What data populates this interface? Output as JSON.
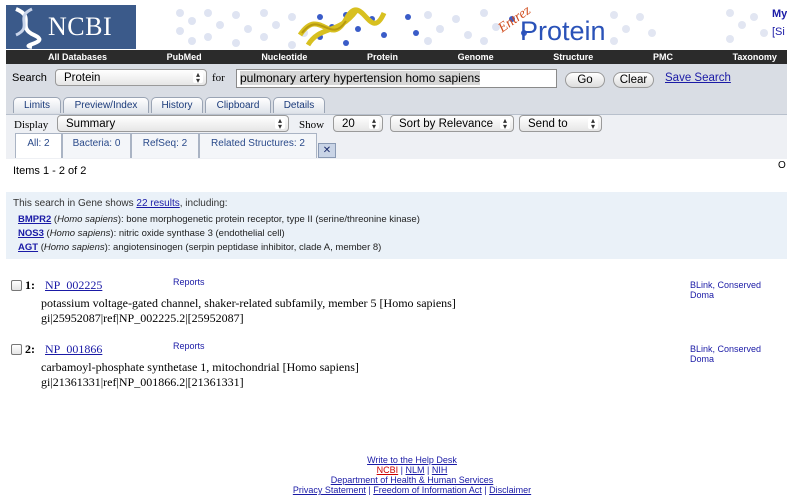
{
  "header": {
    "logo_text": "NCBI",
    "banner_title": "Protein",
    "banner_entrez": "Entrez",
    "my_label": "My",
    "my_sign": "[Si"
  },
  "nav": [
    "All Databases",
    "PubMed",
    "Nucleotide",
    "Protein",
    "Genome",
    "Structure",
    "PMC",
    "Taxonomy"
  ],
  "search": {
    "label": "Search",
    "database": "Protein",
    "for_label": "for",
    "term": "pulmonary artery hypertension homo sapiens",
    "go_label": "Go",
    "clear_label": "Clear",
    "save_label": "Save Search"
  },
  "tabs": [
    "Limits",
    "Preview/Index",
    "History",
    "Clipboard",
    "Details"
  ],
  "display": {
    "label": "Display",
    "value": "Summary",
    "show_label": "Show",
    "show_value": "20",
    "sort_value": "Sort by Relevance",
    "send_value": "Send to"
  },
  "filter_tabs": [
    "All: 2",
    "Bacteria: 0",
    "RefSeq: 2",
    "Related Structures: 2"
  ],
  "items_text": "Items 1 - 2 of 2",
  "edge_text": "O",
  "gene": {
    "intro_pre": "This search in Gene shows ",
    "intro_link": "22 results",
    "intro_post": ", including:",
    "lines": [
      {
        "sym": "BMPR2",
        "org": "Homo sapiens",
        "desc": ": bone morphogenetic protein receptor, type II (serine/threonine kinase)"
      },
      {
        "sym": "NOS3",
        "org": "Homo sapiens",
        "desc": ": nitric oxide synthase 3 (endothelial cell)"
      },
      {
        "sym": "AGT",
        "org": "Homo sapiens",
        "desc": ": angiotensinogen (serpin peptidase inhibitor, clade A, member 8)"
      }
    ]
  },
  "results": [
    {
      "num": "1:",
      "acc": "NP_002225",
      "reports": "Reports",
      "desc": "potassium voltage-gated channel, shaker-related subfamily, member 5 [Homo sapiens]",
      "ids": "gi|25952087|ref|NP_002225.2|[25952087]",
      "links": "BLink, Conserved Doma"
    },
    {
      "num": "2:",
      "acc": "NP_001866",
      "reports": "Reports",
      "desc": "carbamoyl-phosphate synthetase 1, mitochondrial [Homo sapiens]",
      "ids": "gi|21361331|ref|NP_001866.2|[21361331]",
      "links": "BLink, Conserved Doma"
    }
  ],
  "footer": {
    "help": "Write to the Help Desk",
    "ncbi": "NCBI",
    "sep1": " | ",
    "nlm": "NLM",
    "sep2": " | ",
    "nih": "NIH",
    "dept": "Department of Health & Human Services",
    "privacy": "Privacy Statement",
    "sep3": " | ",
    "foia": "Freedom of Information Act",
    "sep4": " | ",
    "disclaimer": "Disclaimer"
  }
}
